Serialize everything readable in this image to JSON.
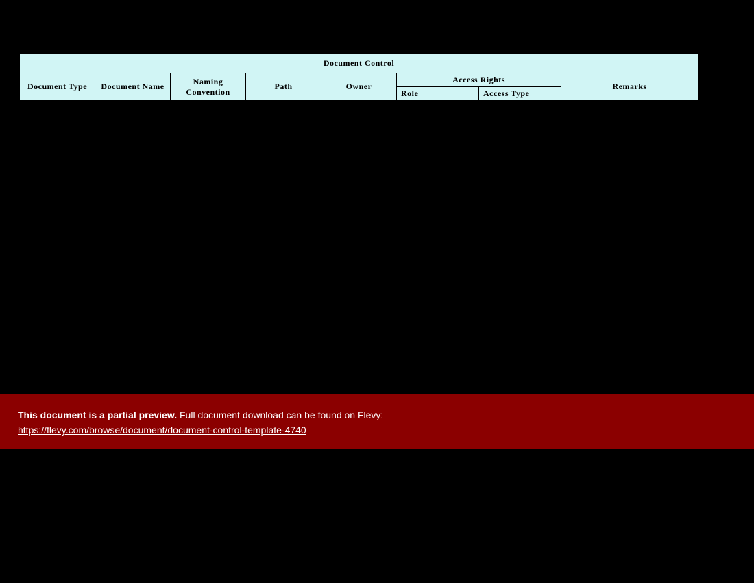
{
  "table": {
    "title": "Document Control",
    "columns": {
      "doc_type": "Document Type",
      "doc_name": "Document Name",
      "naming_conv": "Naming Convention",
      "path": "Path",
      "owner": "Owner",
      "access_rights": "Access Rights",
      "role": "Role",
      "access_type": "Access Type",
      "remarks": "Remarks"
    }
  },
  "banner": {
    "bold": "This document is a partial preview.",
    "rest": "  Full document download can be found on Flevy:",
    "link": "https://flevy.com/browse/document/document-control-template-4740"
  }
}
